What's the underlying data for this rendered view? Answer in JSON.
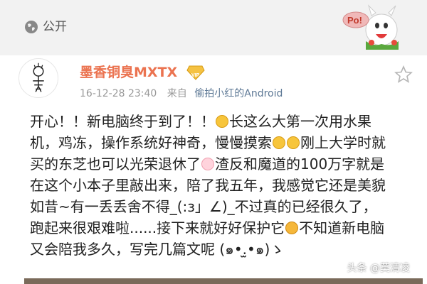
{
  "header": {
    "visibility_label": "公开",
    "globe_icon": "globe-icon",
    "mascot_icon": "po-mascot-sticker"
  },
  "post": {
    "username": "墨香铜臭MXTX",
    "vip_badge_icon": "vip-diamond-icon",
    "favorite_icon": "star-icon",
    "timestamp": "16-12-28 23:40",
    "source_prefix": "来自",
    "source": "偷拍小红的Android",
    "content_lines": [
      [
        "开心！！新电脑终于到了！！",
        "",
        "长这么大第一次用水果"
      ],
      [
        "机，鸡冻，操作系统好神奇，慢慢摸索",
        "",
        "刚上大学时就"
      ],
      [
        "买的东芝也可以光荣退休了",
        "",
        "渣反和魔道的100万字就是"
      ],
      [
        "在这个小本子里敲出来，陪了我五年，我感觉它还是美貌",
        "",
        ""
      ],
      [
        "如昔~有一丢丢舍不得_(:з」∠)_不过真的已经很久了，",
        "",
        ""
      ],
      [
        "跑起来很艰难啦......接下来就好好保护它",
        "",
        "不知道新电脑"
      ],
      [
        "又会陪我多久，写完几篇文呢 (๑•.̫•๑)ゝ",
        "",
        ""
      ]
    ]
  },
  "watermark": "头条 @莫清凌",
  "colors": {
    "username": "#eb7350",
    "source_link": "#5d7895",
    "header_bg": "#f2f2f2"
  }
}
